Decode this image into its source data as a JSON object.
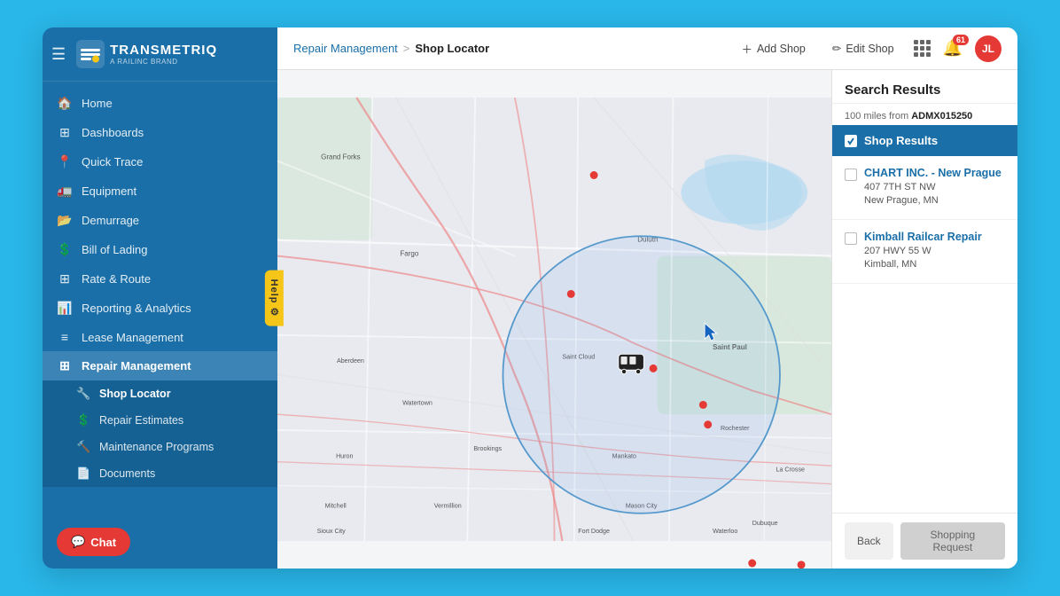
{
  "app": {
    "title": "TRANSMETRIQ",
    "subtitle": "A RAILINC BRAND",
    "hamburger": "☰"
  },
  "topbar": {
    "breadcrumb_parent": "Repair Management",
    "breadcrumb_sep": ">",
    "breadcrumb_current": "Shop Locator",
    "add_shop": "Add Shop",
    "edit_shop": "Edit Shop",
    "notification_count": "61",
    "avatar_initials": "JL"
  },
  "sidebar": {
    "items": [
      {
        "id": "home",
        "label": "Home",
        "icon": "🏠"
      },
      {
        "id": "dashboards",
        "label": "Dashboards",
        "icon": "⊞"
      },
      {
        "id": "quick-trace",
        "label": "Quick Trace",
        "icon": "📍"
      },
      {
        "id": "equipment",
        "label": "Equipment",
        "icon": "🚛"
      },
      {
        "id": "demurrage",
        "label": "Demurrage",
        "icon": "📂"
      },
      {
        "id": "bill-of-lading",
        "label": "Bill of Lading",
        "icon": "💲"
      },
      {
        "id": "rate-route",
        "label": "Rate & Route",
        "icon": "⊞"
      },
      {
        "id": "reporting-analytics",
        "label": "Reporting & Analytics",
        "icon": "📊"
      },
      {
        "id": "lease-management",
        "label": "Lease Management",
        "icon": "≡"
      },
      {
        "id": "repair-management",
        "label": "Repair Management",
        "icon": "⊞",
        "active": true
      }
    ],
    "subnav": [
      {
        "id": "shop-locator",
        "label": "Shop Locator",
        "icon": "🔧",
        "active": true
      },
      {
        "id": "repair-estimates",
        "label": "Repair Estimates",
        "icon": "💲"
      },
      {
        "id": "maintenance-programs",
        "label": "Maintenance Programs",
        "icon": "🔨"
      },
      {
        "id": "documents",
        "label": "Documents",
        "icon": "📄"
      }
    ],
    "chat_label": "Chat",
    "help_label": "Help"
  },
  "search_panel": {
    "title": "Search Results",
    "miles": "100",
    "location_id": "ADMX015250",
    "select_all_label": "Shop Results",
    "results": [
      {
        "name": "CHART INC. - New Prague",
        "address_line1": "407 7TH ST NW",
        "address_line2": "New Prague, MN"
      },
      {
        "name": "Kimball Railcar Repair",
        "address_line1": "207 HWY 55 W",
        "address_line2": "Kimball, MN"
      }
    ],
    "back_btn": "Back",
    "shopping_btn": "Shopping Request"
  }
}
